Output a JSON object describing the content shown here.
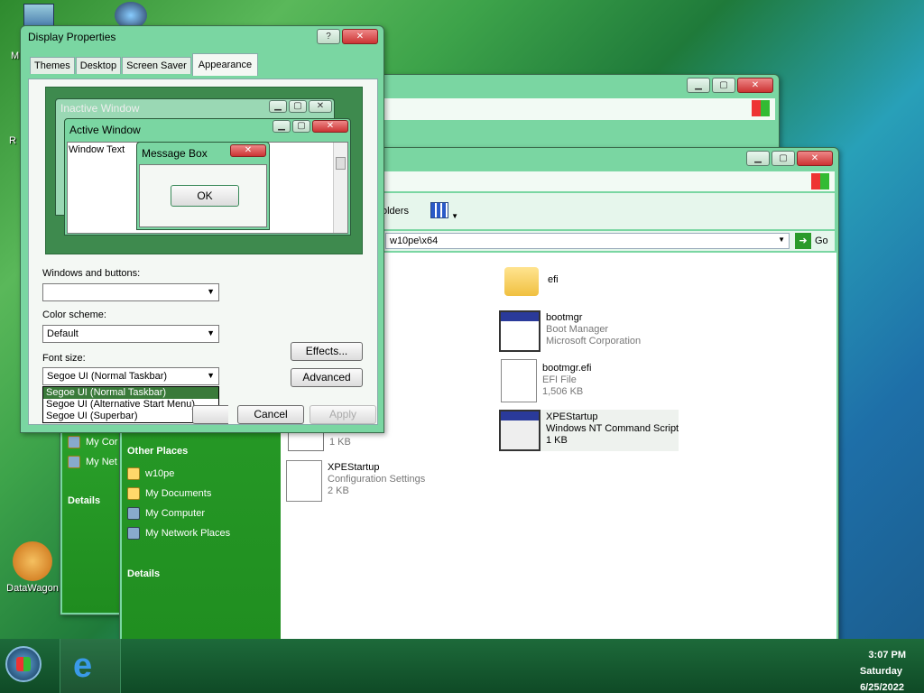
{
  "desktop": {
    "icons": [
      {
        "label": "M"
      },
      {
        "label": "R"
      },
      {
        "label": "DataWagon"
      }
    ]
  },
  "explorer_back": {
    "address_tail": ""
  },
  "explorer_front": {
    "toolbar_label": "olders",
    "address": "w10pe\\x64",
    "go_label": "Go",
    "sidebar": {
      "partial_1": "My Cor",
      "partial_2": "My Net",
      "details_1": "Details",
      "other_places_header": "Other Places",
      "other_places": [
        {
          "label": "w10pe",
          "icon": "folder-icon"
        },
        {
          "label": "My Documents",
          "icon": "documents-icon"
        },
        {
          "label": "My Computer",
          "icon": "computer-icon"
        },
        {
          "label": "My Network Places",
          "icon": "network-icon"
        }
      ],
      "details_2": "Details"
    },
    "files": [
      {
        "name": "efi",
        "line2": "",
        "line3": "",
        "icon": "folder-icon"
      },
      {
        "name": "bootmgr",
        "line2": "Boot Manager",
        "line3": "Microsoft Corporation",
        "icon": "application-icon"
      },
      {
        "name": "bootmgr.efi",
        "line2": "EFI File",
        "line3": "1,506 KB",
        "icon": "efi-file-icon"
      },
      {
        "name": "XPEStartup",
        "line2": "Windows NT Command Script",
        "line3": "1 KB",
        "icon": "script-icon"
      },
      {
        "name": "",
        "line2": "1 KB",
        "line3": "",
        "icon": "file-icon"
      },
      {
        "name": "XPEStartup",
        "line2": "Configuration Settings",
        "line3": "2 KB",
        "icon": "config-icon"
      }
    ]
  },
  "dialog": {
    "title": "Display Properties",
    "tabs": [
      "Themes",
      "Desktop",
      "Screen Saver",
      "Appearance"
    ],
    "active_tab": "Appearance",
    "preview": {
      "inactive_title": "Inactive Window",
      "active_title": "Active Window",
      "window_text": "Window Text",
      "msgbox_title": "Message Box",
      "ok_label": "OK"
    },
    "windows_buttons_label": "Windows and buttons:",
    "windows_buttons_value": "",
    "color_scheme_label": "Color scheme:",
    "color_scheme_value": "Default",
    "font_size_label": "Font size:",
    "font_size_value": "Segoe UI (Normal Taskbar)",
    "font_size_options": [
      "Segoe UI (Normal Taskbar)",
      "Segoe UI (Alternative Start Menu)",
      "Segoe UI (Superbar)"
    ],
    "effects_label": "Effects...",
    "advanced_label": "Advanced",
    "cancel_label": "Cancel",
    "apply_label": "Apply"
  },
  "taskbar": {
    "time": "3:07 PM",
    "day": "Saturday",
    "date": "6/25/2022"
  },
  "colors": {
    "window_frame": "#7ad6a2",
    "sidebar": "#229522",
    "dropdown_highlight": "#3a7a3a"
  }
}
